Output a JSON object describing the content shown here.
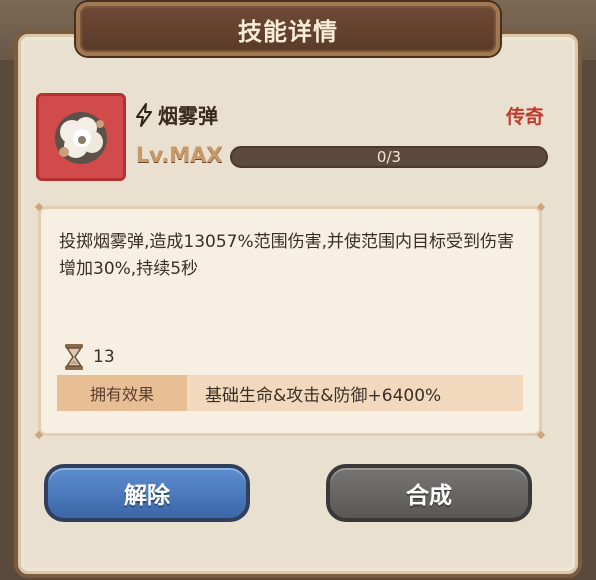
{
  "dialog": {
    "title": "技能详情"
  },
  "skill": {
    "icon": "smoke-bomb-icon",
    "name": "烟雾弹",
    "rarity": "传奇",
    "rarity_color": "#c0392b",
    "level_label": "Lv.MAX",
    "progress_text": "0/3",
    "progress_fraction": 0,
    "description": "投掷烟雾弹,造成13057%范围伤害,并使范围内目标受到伤害增加30%,持续5秒",
    "item_count": "13",
    "effect_label": "拥有效果",
    "effect_value": "基础生命&攻击&防御+6400%"
  },
  "buttons": {
    "release": "解除",
    "compose": "合成"
  }
}
